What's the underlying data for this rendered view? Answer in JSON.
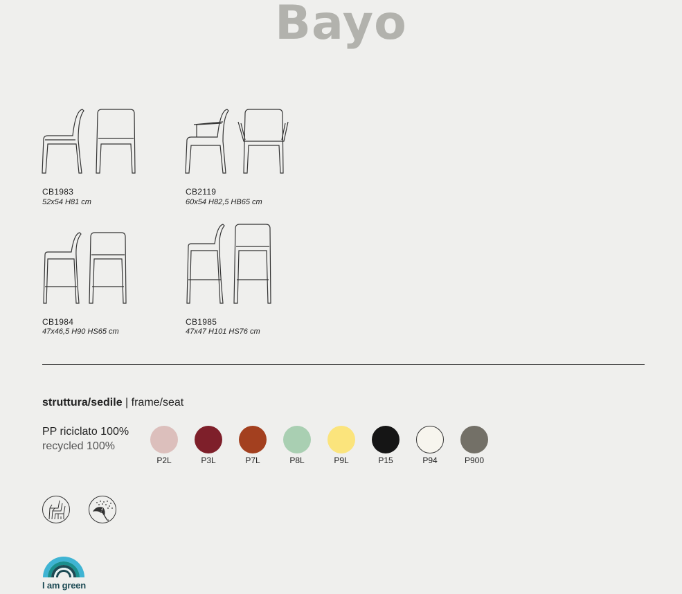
{
  "title": "Bayo",
  "products": [
    {
      "code": "CB1983",
      "dims": "52x54 H81 cm"
    },
    {
      "code": "CB2119",
      "dims": "60x54 H82,5 HB65 cm"
    },
    {
      "code": "CB1984",
      "dims": "47x46,5 H90 HS65 cm"
    },
    {
      "code": "CB1985",
      "dims": "47x47 H101 HS76 cm"
    }
  ],
  "section": {
    "title_bold": "struttura/sedile",
    "title_rest": " | frame/seat"
  },
  "material": {
    "line1": "PP riciclato 100%",
    "line2": "recycled 100%"
  },
  "swatches": [
    {
      "code": "P2L",
      "color": "#dcbfbc"
    },
    {
      "code": "P3L",
      "color": "#7e1f2a"
    },
    {
      "code": "P7L",
      "color": "#a3401f"
    },
    {
      "code": "P8L",
      "color": "#a9cfb2"
    },
    {
      "code": "P9L",
      "color": "#fbe47c"
    },
    {
      "code": "P15",
      "color": "#151515"
    },
    {
      "code": "P94",
      "color": "#f7f5ee"
    },
    {
      "code": "P900",
      "color": "#737067"
    }
  ],
  "icons": [
    "stackable-icon",
    "outdoor-rain-icon"
  ],
  "logo": {
    "text": "I am green",
    "colors": [
      "#3fb4d3",
      "#1a8f8d",
      "#1d4a54",
      "#1d4a54"
    ]
  }
}
